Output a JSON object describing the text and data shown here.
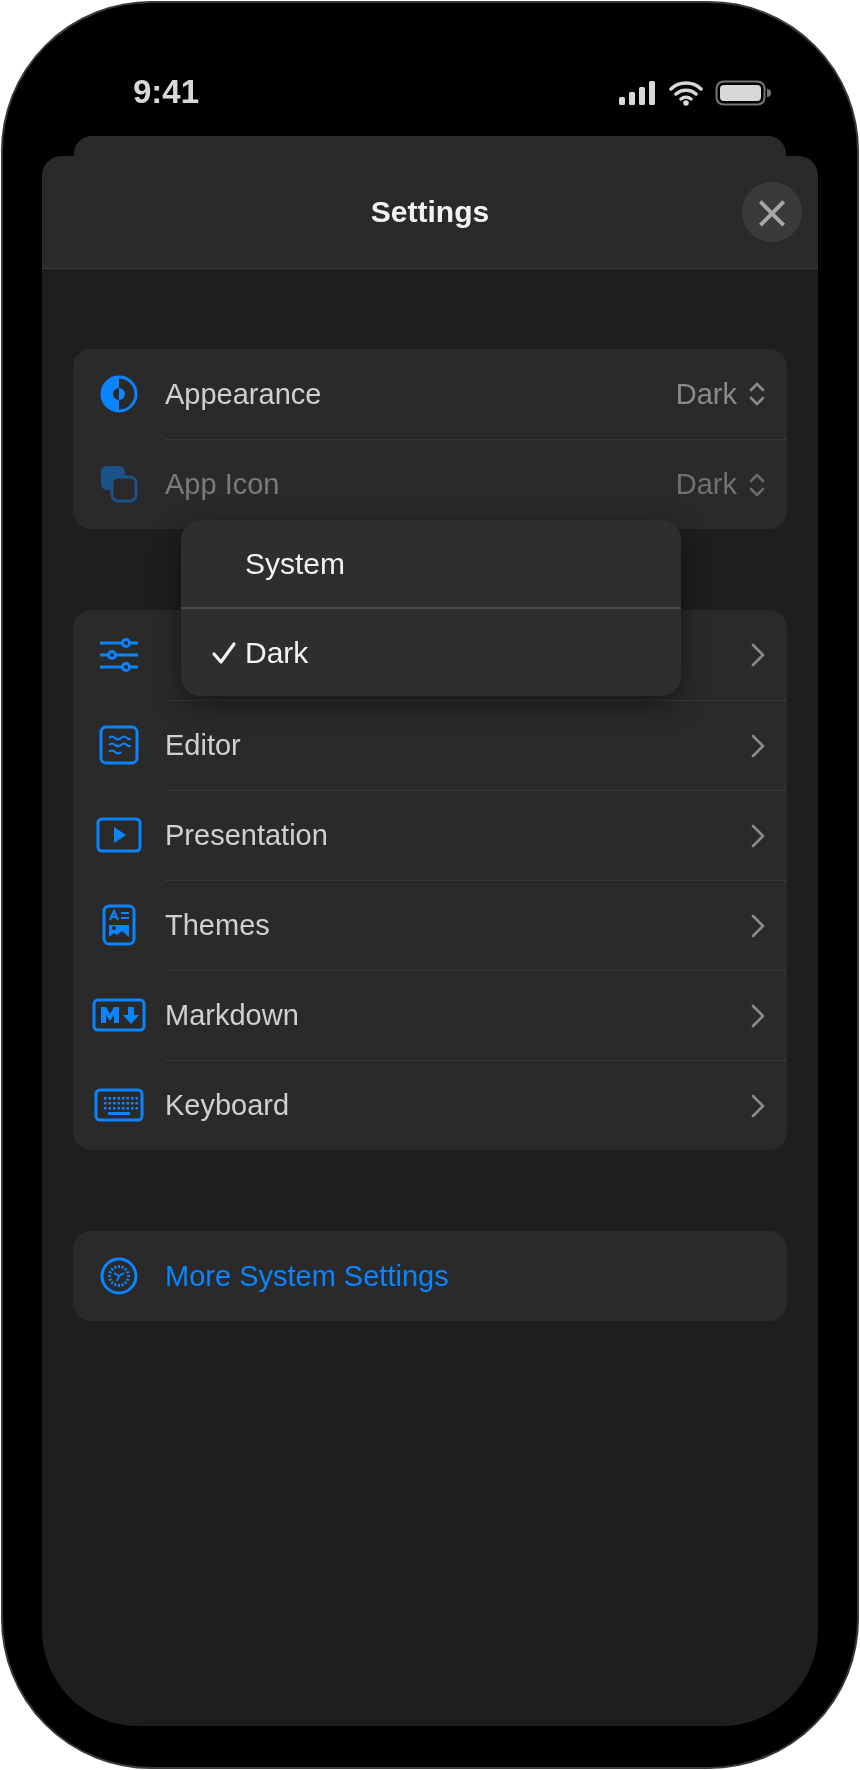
{
  "status_bar": {
    "time": "9:41"
  },
  "sheet": {
    "title": "Settings",
    "close": "×"
  },
  "groups": [
    {
      "rows": [
        {
          "kind": "picker",
          "label": "Appearance",
          "value": "Dark",
          "disabled": false
        },
        {
          "kind": "picker",
          "label": "App Icon",
          "value": "Dark",
          "disabled": true
        }
      ]
    },
    {
      "rows": [
        {
          "kind": "link",
          "disabled": false
        },
        {
          "kind": "link",
          "label": "Editor",
          "disabled": false
        },
        {
          "kind": "link",
          "label": "Presentation",
          "disabled": false
        },
        {
          "kind": "link",
          "label": "Themes",
          "disabled": false
        },
        {
          "kind": "link",
          "label": "Markdown",
          "disabled": false
        },
        {
          "kind": "link",
          "label": "Keyboard",
          "disabled": false
        }
      ]
    },
    {
      "rows": [
        {
          "kind": "action",
          "label": "More System Settings",
          "disabled": false
        }
      ]
    }
  ],
  "menu": {
    "options": [
      {
        "label": "System",
        "selected": false
      },
      {
        "label": "Dark",
        "selected": true
      }
    ]
  }
}
